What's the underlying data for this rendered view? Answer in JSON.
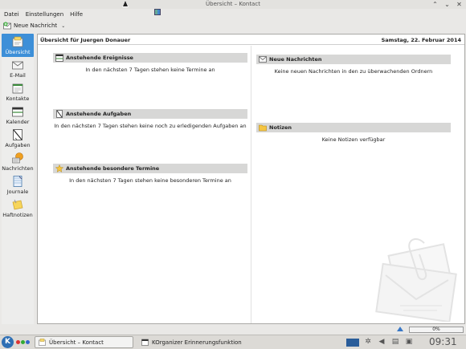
{
  "window": {
    "title": "Übersicht – Kontact",
    "controls": [
      "chevron-up-icon",
      "chevron-down-icon",
      "close-icon"
    ]
  },
  "menubar": {
    "items": [
      {
        "label": "Datei"
      },
      {
        "label": "Einstellungen"
      },
      {
        "label": "Hilfe"
      }
    ]
  },
  "toolbar": {
    "new_message_label": "Neue Nachricht"
  },
  "sidebar": {
    "items": [
      {
        "label": "Übersicht",
        "icon": "overview-icon",
        "active": true
      },
      {
        "label": "E-Mail",
        "icon": "email-icon"
      },
      {
        "label": "Kontakte",
        "icon": "contacts-icon"
      },
      {
        "label": "Kalender",
        "icon": "calendar-icon"
      },
      {
        "label": "Aufgaben",
        "icon": "tasks-icon"
      },
      {
        "label": "Nachrichten",
        "icon": "news-icon"
      },
      {
        "label": "Journale",
        "icon": "journal-icon"
      },
      {
        "label": "Haftnotizen",
        "icon": "sticky-notes-icon"
      }
    ]
  },
  "main": {
    "greeting": "Übersicht für Juergen Donauer",
    "date": "Samstag, 22. Februar 2014",
    "sections": [
      {
        "title": "Anstehende Ereignisse",
        "body": "In den nächsten 7 Tagen stehen keine Termine an"
      },
      {
        "title": "Anstehende Aufgaben",
        "body": "In den nächsten 7 Tagen stehen keine noch zu erledigenden Aufgaben an"
      },
      {
        "title": "Anstehende besondere Termine",
        "body": "In den nächsten 7 Tagen stehen keine besonderen Termine an"
      },
      {
        "title": "Neue Nachrichten",
        "body": "Keine neuen Nachrichten in den zu überwachenden Ordnern"
      },
      {
        "title": "Notizen",
        "body": "Keine Notizen verfügbar"
      }
    ]
  },
  "status": {
    "progress_text": "0%"
  },
  "taskbar": {
    "tasks": [
      {
        "label": "Übersicht – Kontact",
        "active": true
      },
      {
        "label": "KOrganizer Erinnerungsfunktion",
        "active": false
      }
    ],
    "clock": "09:31"
  },
  "colors": {
    "accent": "#3d8fd8",
    "section_header": "#d7d7d6",
    "window_bg": "#e9e8e6"
  }
}
